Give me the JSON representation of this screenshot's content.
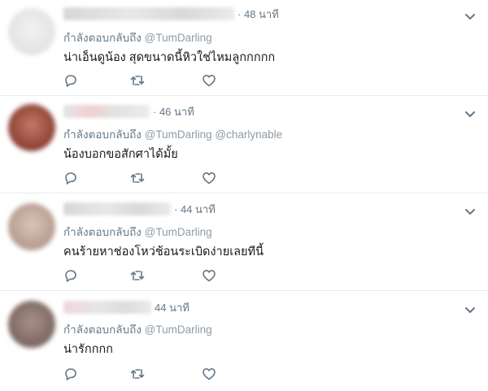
{
  "replying_prefix": "กำลังตอบกลับถึง",
  "replies": [
    {
      "time": "· 48 นาที",
      "mentions": [
        "@TumDarling"
      ],
      "text": "น่าเอ็นดูน้อง สุดขนาดนี้หิวใช่ไหมลูกกกกก",
      "avatar_color": "#e8e8e8"
    },
    {
      "time": "· 46 นาที",
      "mentions": [
        "@TumDarling",
        "@charlynable"
      ],
      "text": "น้องบอกขอสักศาได้มั้ย",
      "avatar_color": "#a35a4a"
    },
    {
      "time": "· 44 นาที",
      "mentions": [
        "@TumDarling"
      ],
      "text": "คนร้ายหาช่องโหว่ช้อนระเบิดง่ายเลยทีนี้",
      "avatar_color": "#c9b3a8"
    },
    {
      "time": "44 นาที",
      "mentions": [
        "@TumDarling"
      ],
      "text": "น่ารักกกก",
      "avatar_color": "#8d7a72"
    }
  ],
  "icons": {
    "reply": "reply-icon",
    "retweet": "retweet-icon",
    "like": "heart-icon",
    "menu": "chevron-down-icon"
  }
}
